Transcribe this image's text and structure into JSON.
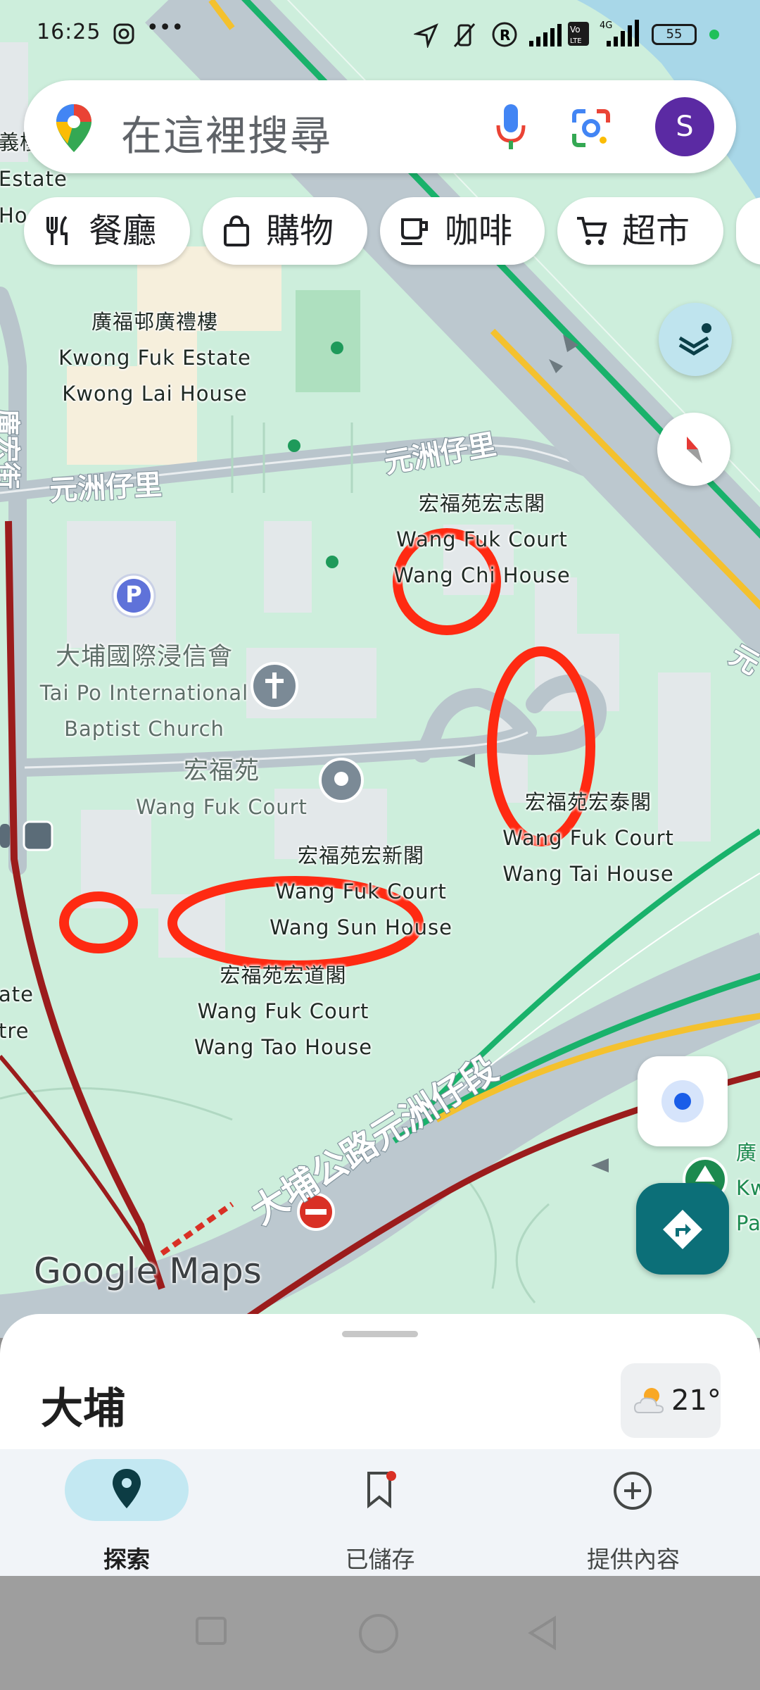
{
  "status_bar": {
    "time": "16:25",
    "battery": "55"
  },
  "search": {
    "placeholder": "在這裡搜尋",
    "avatar_letter": "S"
  },
  "chips": [
    {
      "label": "餐廳",
      "icon": "fork-knife-icon"
    },
    {
      "label": "購物",
      "icon": "shopping-bag-icon"
    },
    {
      "label": "咖啡",
      "icon": "coffee-cup-icon"
    },
    {
      "label": "超市",
      "icon": "shopping-cart-icon"
    }
  ],
  "map_labels": {
    "kwong_lai_zh": "廣福邨廣禮樓",
    "kwong_lai_en1": "Kwong Fuk Estate",
    "kwong_lai_en2": "Kwong Lai House",
    "edge_estate_zh": "義樓",
    "edge_estate_en": "Estate",
    "edge_ho": "Ho",
    "yuen_chau_lane_1": "元洲仔里",
    "yuen_chau_lane_2": "元洲仔里",
    "kwong_fuk_street": "廣宏街",
    "wang_chi_zh": "宏福苑宏志閣",
    "wang_chi_en1": "Wang Fuk Court",
    "wang_chi_en2": "Wang Chi House",
    "church_zh": "大埔國際浸信會",
    "church_en1": "Tai Po International",
    "church_en2": "Baptist Church",
    "court_zh": "宏福苑",
    "court_en": "Wang Fuk Court",
    "wang_tai_zh": "宏福苑宏泰閣",
    "wang_tai_en1": "Wang Fuk Court",
    "wang_tai_en2": "Wang Tai House",
    "wang_sun_zh": "宏福苑宏新閣",
    "wang_sun_en1": "Wang Fuk Court",
    "wang_sun_en2": "Wang Sun House",
    "wang_tao_zh": "宏福苑宏道閣",
    "wang_tao_en1": "Wang Fuk Court",
    "wang_tao_en2": "Wang Tao House",
    "edge_ate": "ate",
    "edge_tre": "tre",
    "main_road": "大埔公路元洲仔段",
    "edge_right_zh": "廣",
    "edge_right_kw": "Kw",
    "edge_right_pa": "Pa",
    "edge_right_yuen": "元",
    "watermark": "Google Maps",
    "parking": "P"
  },
  "bottom_sheet": {
    "place": "大埔",
    "temperature": "21°",
    "weather_icon": "partly-cloudy-icon"
  },
  "bottom_nav": [
    {
      "label": "探索",
      "icon": "map-pin-icon",
      "active": true
    },
    {
      "label": "已儲存",
      "icon": "bookmark-icon",
      "active": false
    },
    {
      "label": "提供內容",
      "icon": "add-circle-icon",
      "active": false
    }
  ],
  "colors": {
    "map_background": "#cdeedc",
    "road": "#b9c5cc",
    "traffic_green": "#19b26b",
    "traffic_yellow": "#f4c12e",
    "traffic_red": "#9b1c1c",
    "annotation_red": "#ff2a12",
    "accent": "#0c6f78"
  }
}
